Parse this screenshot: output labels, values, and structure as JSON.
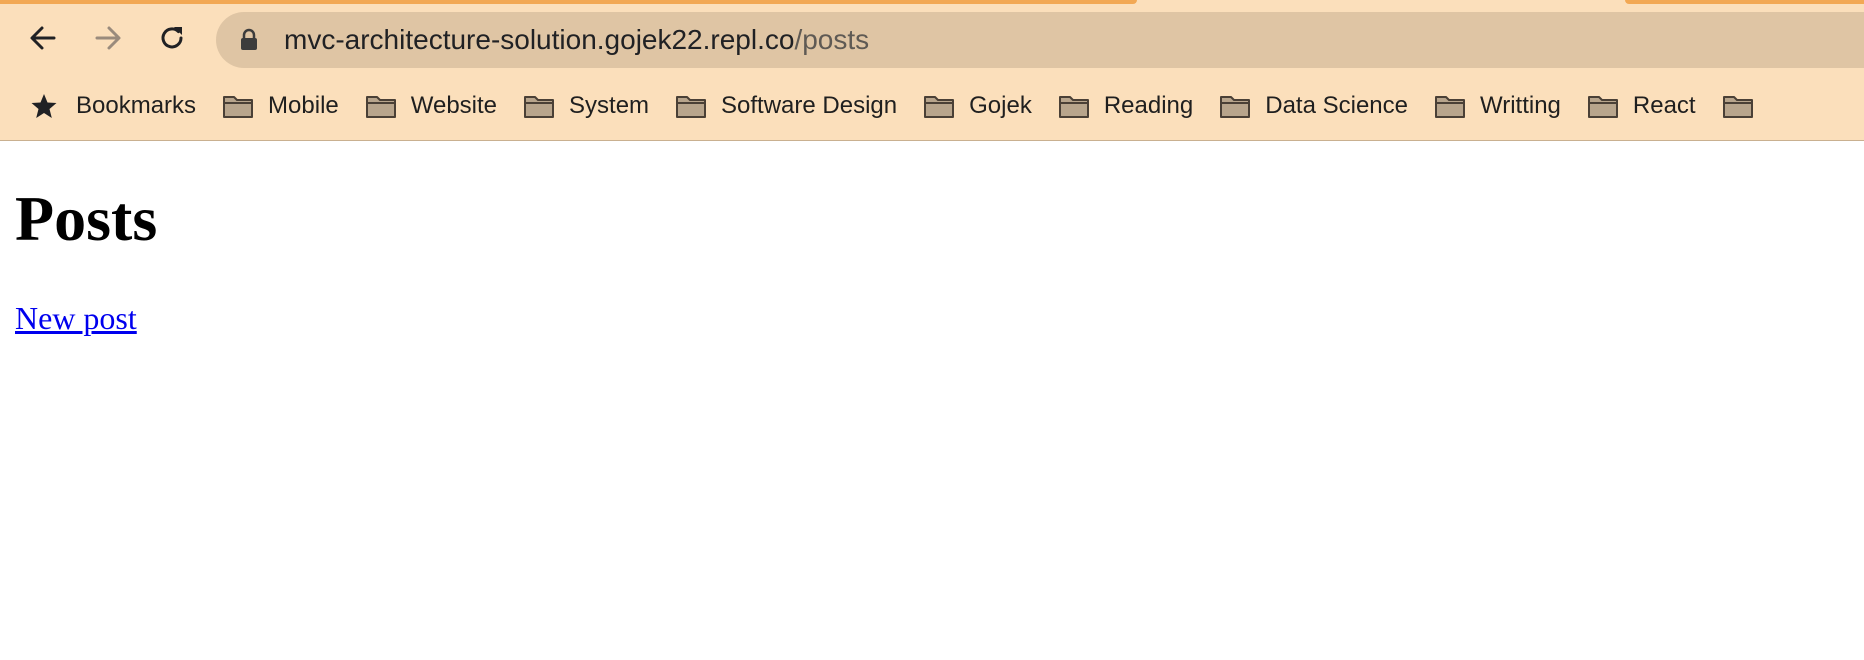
{
  "browser": {
    "url_host": "mvc-architecture-solution.gojek22.repl.co",
    "url_path": "/posts",
    "icons": {
      "back": "back-arrow-icon",
      "forward": "forward-arrow-icon",
      "reload": "reload-icon",
      "secure": "lock-icon"
    },
    "colors": {
      "chrome_background": "#fbdfbb",
      "omnibox_background": "#dfc5a4",
      "tab_accent": "#f2a854"
    }
  },
  "bookmarks": {
    "items": [
      {
        "label": "Bookmarks",
        "icon": "star-icon"
      },
      {
        "label": "Mobile",
        "icon": "folder-icon"
      },
      {
        "label": "Website",
        "icon": "folder-icon"
      },
      {
        "label": "System",
        "icon": "folder-icon"
      },
      {
        "label": "Software Design",
        "icon": "folder-icon"
      },
      {
        "label": "Gojek",
        "icon": "folder-icon"
      },
      {
        "label": "Reading",
        "icon": "folder-icon"
      },
      {
        "label": "Data Science",
        "icon": "folder-icon"
      },
      {
        "label": "Writting",
        "icon": "folder-icon"
      },
      {
        "label": "React",
        "icon": "folder-icon"
      }
    ]
  },
  "page": {
    "title": "Posts",
    "new_post_link": "New post",
    "link_color": "#0000ee"
  }
}
